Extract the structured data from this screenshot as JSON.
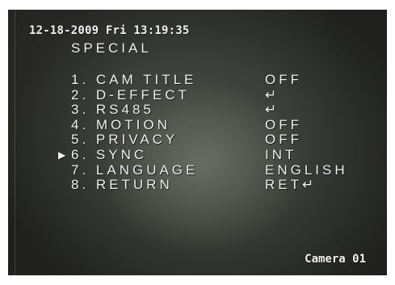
{
  "overlay": {
    "timestamp": "12-18-2009 Fri 13:19:35",
    "menu_title": "SPECIAL",
    "cursor_glyph": "▶",
    "camera_label": "Camera 01"
  },
  "menu": {
    "items": [
      {
        "label": "1. CAM TITLE",
        "value": "OFF",
        "selected": false
      },
      {
        "label": "2. D-EFFECT",
        "value": "↵",
        "selected": false
      },
      {
        "label": "3. RS485",
        "value": "↵",
        "selected": false
      },
      {
        "label": "4. MOTION",
        "value": "OFF",
        "selected": false
      },
      {
        "label": "5. PRIVACY",
        "value": "OFF",
        "selected": false
      },
      {
        "label": "6. SYNC",
        "value": "INT",
        "selected": true
      },
      {
        "label": "7. LANGUAGE",
        "value": "ENGLISH",
        "selected": false
      },
      {
        "label": "8. RETURN",
        "value": "RET↵",
        "selected": false
      }
    ]
  }
}
